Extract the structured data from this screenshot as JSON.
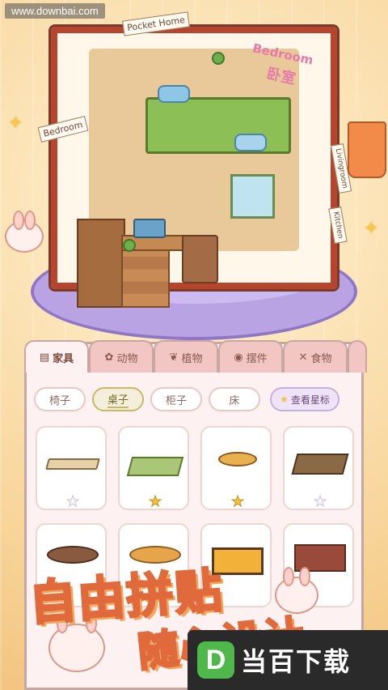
{
  "watermark": "www.downbai.com",
  "scene": {
    "labels": {
      "pocket_home": "Pocket Home",
      "bedroom": "Bedroom",
      "bedroom_cn": "卧室",
      "left_card": "Bedroom",
      "right_card": "Livingroom",
      "kitchen": "Kitchen"
    }
  },
  "categories": [
    {
      "label": "家具",
      "icon": "cabinet-icon",
      "glyph": "▤",
      "active": true
    },
    {
      "label": "动物",
      "icon": "bunny-icon",
      "glyph": "✿",
      "active": false
    },
    {
      "label": "植物",
      "icon": "plant-icon",
      "glyph": "❦",
      "active": false
    },
    {
      "label": "摆件",
      "icon": "ornament-icon",
      "glyph": "◉",
      "active": false
    },
    {
      "label": "食物",
      "icon": "utensils-icon",
      "glyph": "✕",
      "active": false
    }
  ],
  "subcategories": [
    {
      "label": "椅子",
      "active": false
    },
    {
      "label": "桌子",
      "active": true
    },
    {
      "label": "柜子",
      "active": false
    },
    {
      "label": "床",
      "active": false
    }
  ],
  "favorites_button": "查看星标",
  "items": [
    {
      "name": "wood-bench-table",
      "favorited": false
    },
    {
      "name": "green-desk",
      "favorited": true
    },
    {
      "name": "round-side-table",
      "favorited": true
    },
    {
      "name": "brown-coffee-table",
      "favorited": false
    },
    {
      "name": "round-dark-table",
      "favorited": false
    },
    {
      "name": "round-orange-table",
      "favorited": false
    },
    {
      "name": "square-yellow-table",
      "favorited": false
    },
    {
      "name": "red-wood-table",
      "favorited": false
    }
  ],
  "promo": {
    "line1": "自由拼贴",
    "line2": "随心设计"
  },
  "brand": {
    "logo": "D",
    "name": "当百下载"
  },
  "colors": {
    "accent": "#e06a3c",
    "panel": "#fdf1f1",
    "star": "#f3c33d"
  }
}
